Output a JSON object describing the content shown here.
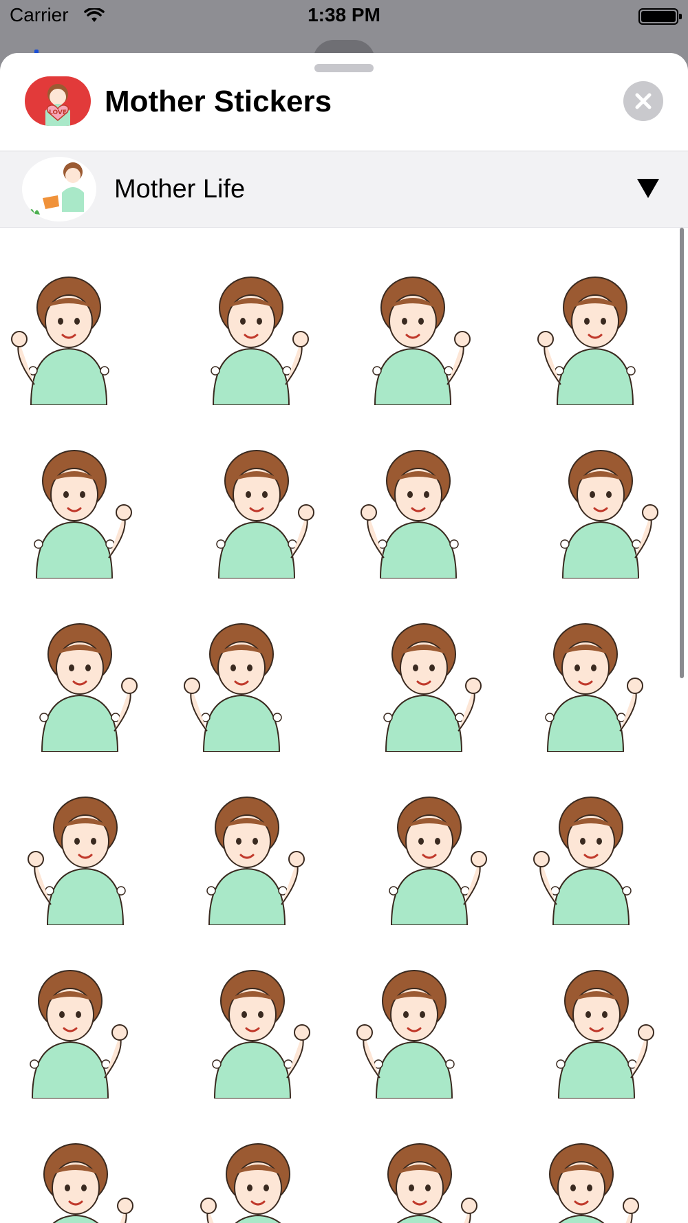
{
  "status_bar": {
    "carrier": "Carrier",
    "time": "1:38 PM",
    "battery_level": 1.0
  },
  "app": {
    "title": "Mother Stickers",
    "icon": "mother-love-sticker-icon",
    "close_icon": "close-icon"
  },
  "pack": {
    "name": "Mother Life",
    "thumbnail": "mother-watering-plants-thumbnail",
    "toggle_icon": "triangle-down-icon"
  },
  "colors": {
    "shirt": "#a9e8c8",
    "hair": "#9b5a32",
    "skin": "#fde6d6",
    "outline": "#3a2a20",
    "sheet": "#ffffff",
    "pack_bar": "#f2f2f4",
    "close_bg": "#c9c9cd"
  },
  "stickers": [
    {
      "name": "watering-plants"
    },
    {
      "name": "sick-in-bed"
    },
    {
      "name": "relaxing-lounge-chair"
    },
    {
      "name": "traffic-light"
    },
    {
      "name": "holding-puppy"
    },
    {
      "name": "cooking-greens"
    },
    {
      "name": "apron-spatula"
    },
    {
      "name": "waiting-clock"
    },
    {
      "name": "hugging-bear"
    },
    {
      "name": "fanning-hot"
    },
    {
      "name": "fruit-basket"
    },
    {
      "name": "washing-dishes"
    },
    {
      "name": "clapping-laugh"
    },
    {
      "name": "phone-call-happy"
    },
    {
      "name": "face-mask-bed"
    },
    {
      "name": "blushing"
    },
    {
      "name": "thumbs-up"
    },
    {
      "name": "angry-fist"
    },
    {
      "name": "frying-pan"
    },
    {
      "name": "peace-signs"
    },
    {
      "name": "laughing-hard"
    },
    {
      "name": "headache"
    },
    {
      "name": "ok-sign"
    },
    {
      "name": "pointing-wink"
    }
  ]
}
